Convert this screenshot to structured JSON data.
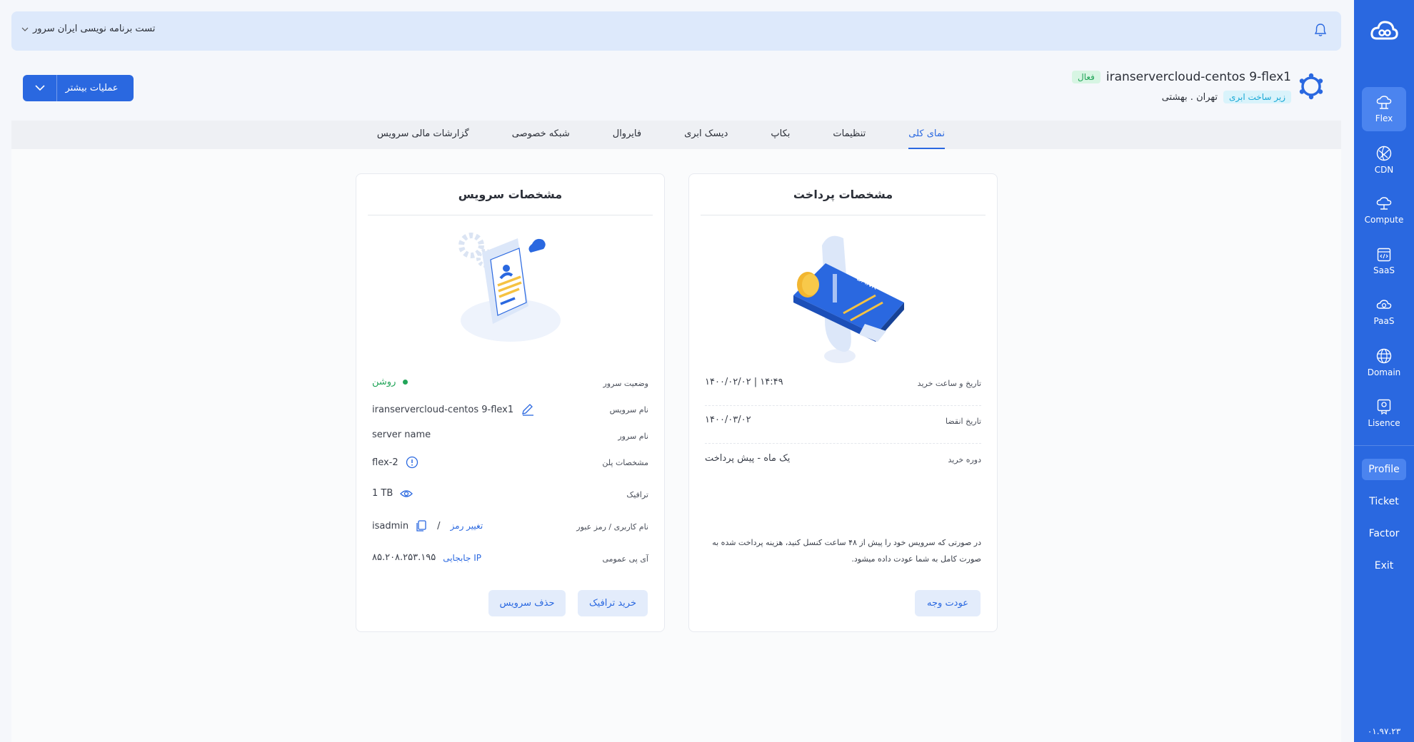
{
  "company": {
    "name": "تست برنامه نویسی ایران سرور"
  },
  "service": {
    "name": "iranservercloud-centos 9-flex1",
    "status_badge": "فعال",
    "infra_badge": "زیر ساخت ابری",
    "location": "تهران . بهشتی",
    "more_button": "عملیات بیشتر"
  },
  "tabs": [
    {
      "label": "نمای کلی",
      "active": true
    },
    {
      "label": "تنظیمات"
    },
    {
      "label": "بکاپ"
    },
    {
      "label": "دیسک ابری"
    },
    {
      "label": "فایروال"
    },
    {
      "label": "شبکه خصوصی"
    },
    {
      "label": "گزارشات مالی سرویس"
    }
  ],
  "payment": {
    "title": "مشخصات پرداخت",
    "purchase_label": "تاریخ و ساعت خرید",
    "purchase_value": "۱۴۰۰/۰۲/۰۲ | ۱۴:۴۹",
    "expire_label": "تاریخ انقضا",
    "expire_value": "۱۴۰۰/۰۳/۰۲",
    "period_label": "دوره خرید",
    "period_value": "یک ماه - پیش پرداخت",
    "note": "در صورتی که سرویس خود را پیش از ۴۸ ساعت کنسل کنید، هزینه پرداخت شده به صورت کامل به شما عودت داده میشود.",
    "refund_button": "عودت وجه"
  },
  "spec": {
    "title": "مشخصات سرویس",
    "status_label": "وضعیت سرور",
    "status_value": "روشن",
    "service_name_label": "نام سرویس",
    "service_name_value": "iranservercloud-centos 9-flex1",
    "server_name_label": "نام سرور",
    "server_name_value": "server name",
    "plan_label": "مشخصات پلن",
    "plan_value": "flex-2",
    "traffic_label": "ترافیک",
    "traffic_value": "1 TB",
    "user_label": "نام کاربری / رمز عبور",
    "user_value": "isadmin",
    "change_pass": "تغییر رمز",
    "slash": "/",
    "ip_label": "آی پی عمومی",
    "ip_value": "۸۵.۲۰۸.۲۵۳.۱۹۵",
    "ip_move": "جابجایی IP",
    "buy_traffic_button": "خرید ترافیک",
    "delete_button": "حذف سرویس"
  },
  "sidebar": {
    "items": [
      {
        "label": "Flex",
        "icon": "cloud-server-icon",
        "active": true
      },
      {
        "label": "CDN",
        "icon": "globe-net-icon"
      },
      {
        "label": "Compute",
        "icon": "cloud-compute-icon"
      },
      {
        "label": "SaaS",
        "icon": "code-window-icon"
      },
      {
        "label": "PaaS",
        "icon": "cloud-gear-icon"
      },
      {
        "label": "Domain",
        "icon": "globe-icon"
      },
      {
        "label": "Lisence",
        "icon": "license-icon"
      }
    ],
    "links": [
      {
        "label": "Profile",
        "active": true
      },
      {
        "label": "Ticket"
      },
      {
        "label": "Factor"
      },
      {
        "label": "Exit"
      }
    ],
    "version": "۰۱.۹۷.۲۳"
  },
  "colors": {
    "primary": "#2a68e0",
    "success": "#22a559",
    "info": "#18a8d6",
    "topbar": "#dde9fb"
  }
}
